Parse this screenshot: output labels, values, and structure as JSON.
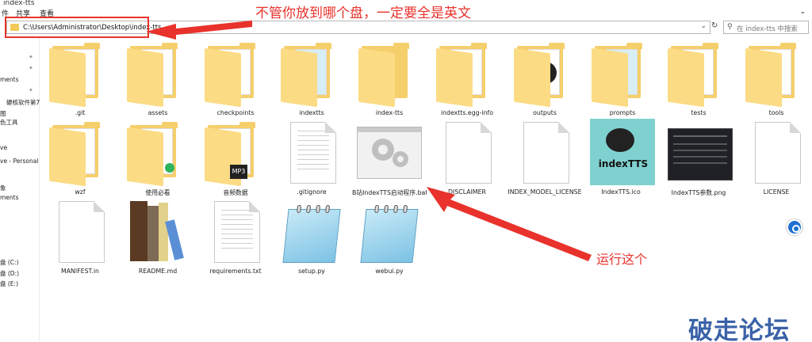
{
  "window": {
    "title": "index-tts"
  },
  "ribbon": {
    "tabs": [
      "件",
      "共享",
      "查看"
    ]
  },
  "address": {
    "path": "C:\\Users\\Administrator\\Desktop\\index-tts"
  },
  "search": {
    "placeholder": "在 index-tts 中搜索"
  },
  "nav": {
    "items": [
      "ments",
      "硬核软件第7",
      "图",
      "色工具",
      "ve",
      "ve - Personal",
      "象",
      "ments",
      "盘 (C:)",
      "盘 (D:)",
      "盘 (E:)"
    ]
  },
  "files": [
    {
      "name": ".git",
      "kind": "folder"
    },
    {
      "name": "assets",
      "kind": "folder"
    },
    {
      "name": "checkpoints",
      "kind": "folder"
    },
    {
      "name": "indextts",
      "kind": "folder"
    },
    {
      "name": "index-tts",
      "kind": "folder"
    },
    {
      "name": "indextts.egg-info",
      "kind": "folder"
    },
    {
      "name": "outputs",
      "kind": "folder"
    },
    {
      "name": "prompts",
      "kind": "folder"
    },
    {
      "name": "tests",
      "kind": "folder"
    },
    {
      "name": "tools",
      "kind": "folder"
    },
    {
      "name": "wzf",
      "kind": "folder"
    },
    {
      "name": "使用必看",
      "kind": "folder"
    },
    {
      "name": "音频数据",
      "kind": "folder"
    },
    {
      "name": ".gitignore",
      "kind": "doc"
    },
    {
      "name": "B站IndexTTS启动程序.bat",
      "kind": "bat"
    },
    {
      "name": "DISCLAIMER",
      "kind": "doc"
    },
    {
      "name": "INDEX_MODEL_LICENSE",
      "kind": "doc"
    },
    {
      "name": "IndexTTS.ico",
      "kind": "ico"
    },
    {
      "name": "IndexTTS参数.png",
      "kind": "png"
    },
    {
      "name": "LICENSE",
      "kind": "doc"
    },
    {
      "name": "MANIFEST.in",
      "kind": "doc"
    },
    {
      "name": "README.md",
      "kind": "books"
    },
    {
      "name": "requirements.txt",
      "kind": "lines"
    },
    {
      "name": "setup.py",
      "kind": "pad"
    },
    {
      "name": "webui.py",
      "kind": "pad"
    }
  ],
  "annotations": {
    "top": "不管你放到哪个盘，一定要全是英文",
    "run": "运行这个",
    "watermark": "破走论坛",
    "ico_text": "indexTTS",
    "mp3": "MP3"
  },
  "colors": {
    "accent": "#e8322b",
    "folder": "#f5cf6b",
    "brand": "#3b62a8"
  }
}
